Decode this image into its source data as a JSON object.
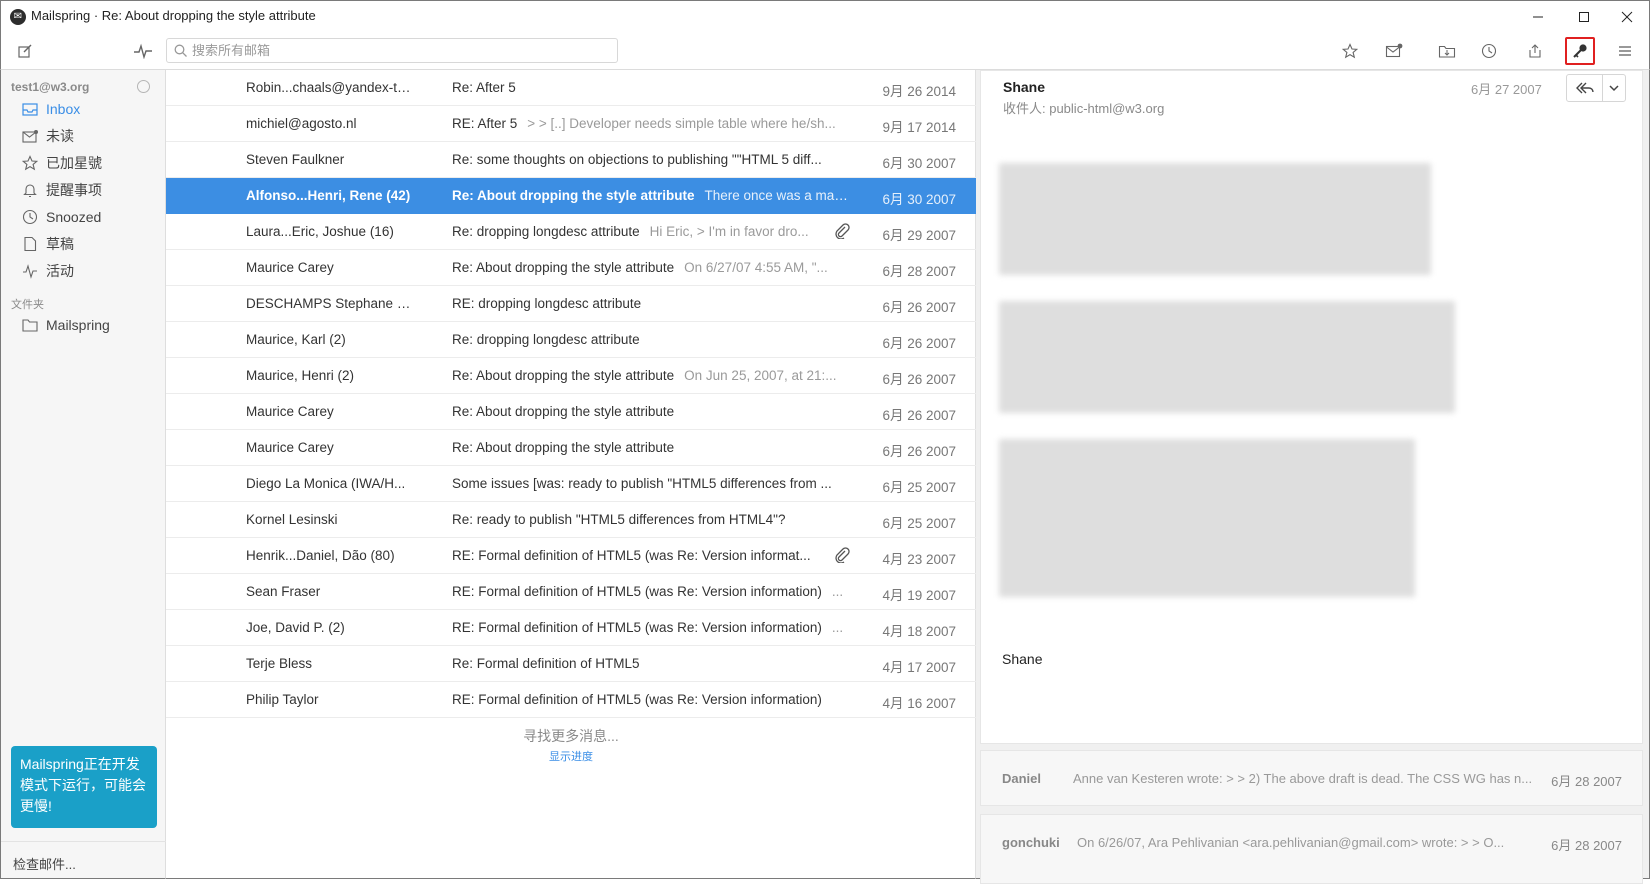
{
  "window": {
    "title": "Mailspring · Re: About dropping the style attribute",
    "logo_glyph": "✉"
  },
  "search": {
    "placeholder": "搜索所有邮箱"
  },
  "sidebar": {
    "account": "test1@w3.org",
    "items": [
      {
        "label": "Inbox",
        "icon": "inbox-icon"
      },
      {
        "label": "未读",
        "icon": "unread-icon"
      },
      {
        "label": "已加星號",
        "icon": "star-icon"
      },
      {
        "label": "提醒事项",
        "icon": "bell-icon"
      },
      {
        "label": "Snoozed",
        "icon": "clock-icon"
      },
      {
        "label": "草稿",
        "icon": "draft-icon"
      },
      {
        "label": "活动",
        "icon": "activity-icon"
      }
    ],
    "folders_label": "文件夹",
    "folders": [
      {
        "label": "Mailspring",
        "icon": "folder-icon"
      }
    ],
    "dev_banner": "Mailspring正在开发模式下运行，可能会更慢!",
    "sync_status": "检查邮件..."
  },
  "messages": [
    {
      "from": "Robin...chaals@yandex-te...",
      "subject": "Re: After 5",
      "snippet": "",
      "date": "9月 26 2014"
    },
    {
      "from": "michiel@agosto.nl",
      "subject": "RE: After 5",
      "snippet": "> > [..] Developer needs simple table where he/sh...",
      "date": "9月 17 2014"
    },
    {
      "from": "Steven Faulkner",
      "subject": "Re: some thoughts on objections to publishing \"\"HTML 5 diff...",
      "snippet": "",
      "date": "6月 30 2007"
    },
    {
      "from": "Alfonso...Henri, Rene (42)",
      "subject": "Re: About dropping the style attribute",
      "snippet": "There once was a mast...",
      "date": "6月 30 2007"
    },
    {
      "from": "Laura...Eric, Joshue (16)",
      "subject": "Re: dropping longdesc attribute",
      "snippet": "Hi Eric, > I'm in favor dro...",
      "date": "6月 29 2007"
    },
    {
      "from": "Maurice Carey",
      "subject": "Re: About dropping the style attribute",
      "snippet": "On 6/27/07 4:55 AM, \"...",
      "date": "6月 28 2007"
    },
    {
      "from": "DESCHAMPS Stephane R...",
      "subject": "RE: dropping longdesc attribute",
      "snippet": "",
      "date": "6月 26 2007"
    },
    {
      "from": "Maurice, Karl (2)",
      "subject": "Re: dropping longdesc attribute",
      "snippet": "",
      "date": "6月 26 2007"
    },
    {
      "from": "Maurice, Henri (2)",
      "subject": "Re: About dropping the style attribute",
      "snippet": "On Jun 25, 2007, at 21:...",
      "date": "6月 26 2007"
    },
    {
      "from": "Maurice Carey",
      "subject": "Re: About dropping the style attribute",
      "snippet": "",
      "date": "6月 26 2007"
    },
    {
      "from": "Maurice Carey",
      "subject": "Re: About dropping the style attribute",
      "snippet": "",
      "date": "6月 26 2007"
    },
    {
      "from": "Diego La Monica (IWA/H...",
      "subject": "Some issues [was: ready to publish \"HTML5 differences from ...",
      "snippet": "",
      "date": "6月 25 2007"
    },
    {
      "from": "Kornel Lesinski",
      "subject": "Re: ready to publish \"HTML5 differences from HTML4\"?",
      "snippet": "",
      "date": "6月 25 2007"
    },
    {
      "from": "Henrik...Daniel, Dão (80)",
      "subject": "RE: Formal definition of HTML5 (was Re: Version informat...",
      "snippet": "",
      "date": "4月 23 2007"
    },
    {
      "from": "Sean Fraser",
      "subject": "RE: Formal definition of HTML5 (was Re: Version information)",
      "snippet": "...",
      "date": "4月 19 2007"
    },
    {
      "from": "Joe, David P. (2)",
      "subject": "RE: Formal definition of HTML5 (was Re: Version information)",
      "snippet": "...",
      "date": "4月 18 2007"
    },
    {
      "from": "Terje Bless",
      "subject": "Re: Formal definition of HTML5",
      "snippet": "",
      "date": "4月 17 2007"
    },
    {
      "from": "Philip Taylor",
      "subject": "RE: Formal definition of HTML5 (was Re: Version information)",
      "snippet": "",
      "date": "4月 16 2007"
    }
  ],
  "list_footer": {
    "more": "寻找更多消息...",
    "progress": "显示进度"
  },
  "reader": {
    "from": "Shane",
    "to": "收件人: public-html@w3.org",
    "date": "6月 27 2007",
    "signature": "Shane",
    "collapsed": [
      {
        "from": "Daniel",
        "snippet": "Anne van Kesteren wrote: > > 2) The above draft is dead. The CSS WG has n...",
        "date": "6月 28 2007"
      },
      {
        "from": "gonchuki",
        "snippet": "On 6/26/07, Ara Pehlivanian <ara.pehlivanian@gmail.com> wrote: > > O...",
        "date": "6月 28 2007"
      }
    ]
  },
  "colors": {
    "accent": "#3a8ee6",
    "selected_row": "#3c8ee3",
    "dev_banner": "#1aa0c8",
    "highlight_box": "#e02020"
  }
}
